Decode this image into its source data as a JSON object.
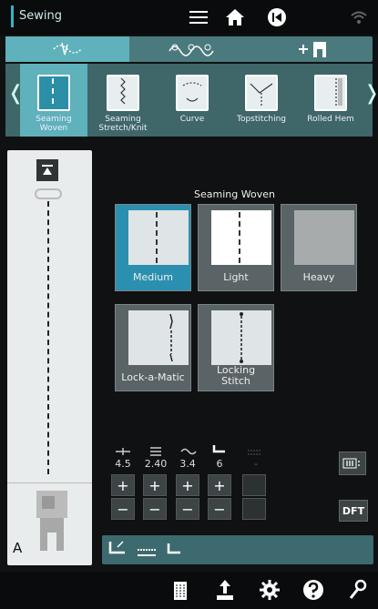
{
  "app": {
    "title": "Sewing"
  },
  "categories": [
    {
      "label_l1": "Seaming",
      "label_l2": "Woven",
      "active": true
    },
    {
      "label_l1": "Seaming",
      "label_l2": "Stretch/Knit",
      "active": false
    },
    {
      "label_l1": "Curve",
      "label_l2": "",
      "active": false
    },
    {
      "label_l1": "Topstitching",
      "label_l2": "",
      "active": false
    },
    {
      "label_l1": "Rolled Hem",
      "label_l2": "",
      "active": false
    }
  ],
  "leftpanel": {
    "presser_foot_letter": "A"
  },
  "main": {
    "section_title": "Seaming Woven",
    "tiles": [
      {
        "label": "Medium",
        "selected": true
      },
      {
        "label": "Light",
        "selected": false
      },
      {
        "label": "Heavy",
        "selected": false
      },
      {
        "label": "Lock-a-Matic",
        "selected": false
      },
      {
        "label_l1": "Locking",
        "label_l2": "Stitch",
        "selected": false
      }
    ],
    "params": [
      {
        "name": "stitch-width",
        "value": "4.5"
      },
      {
        "name": "stitch-length",
        "value": "2.40"
      },
      {
        "name": "thread-tension",
        "value": "3.4"
      },
      {
        "name": "presser-foot-pressure",
        "value": "6"
      },
      {
        "name": "disabled-param",
        "value": "-"
      }
    ],
    "dft_label": "DFT"
  },
  "colors": {
    "accent": "#5fb1bb",
    "selected_tile": "#2b8fb0",
    "panel": "#3f6669"
  }
}
